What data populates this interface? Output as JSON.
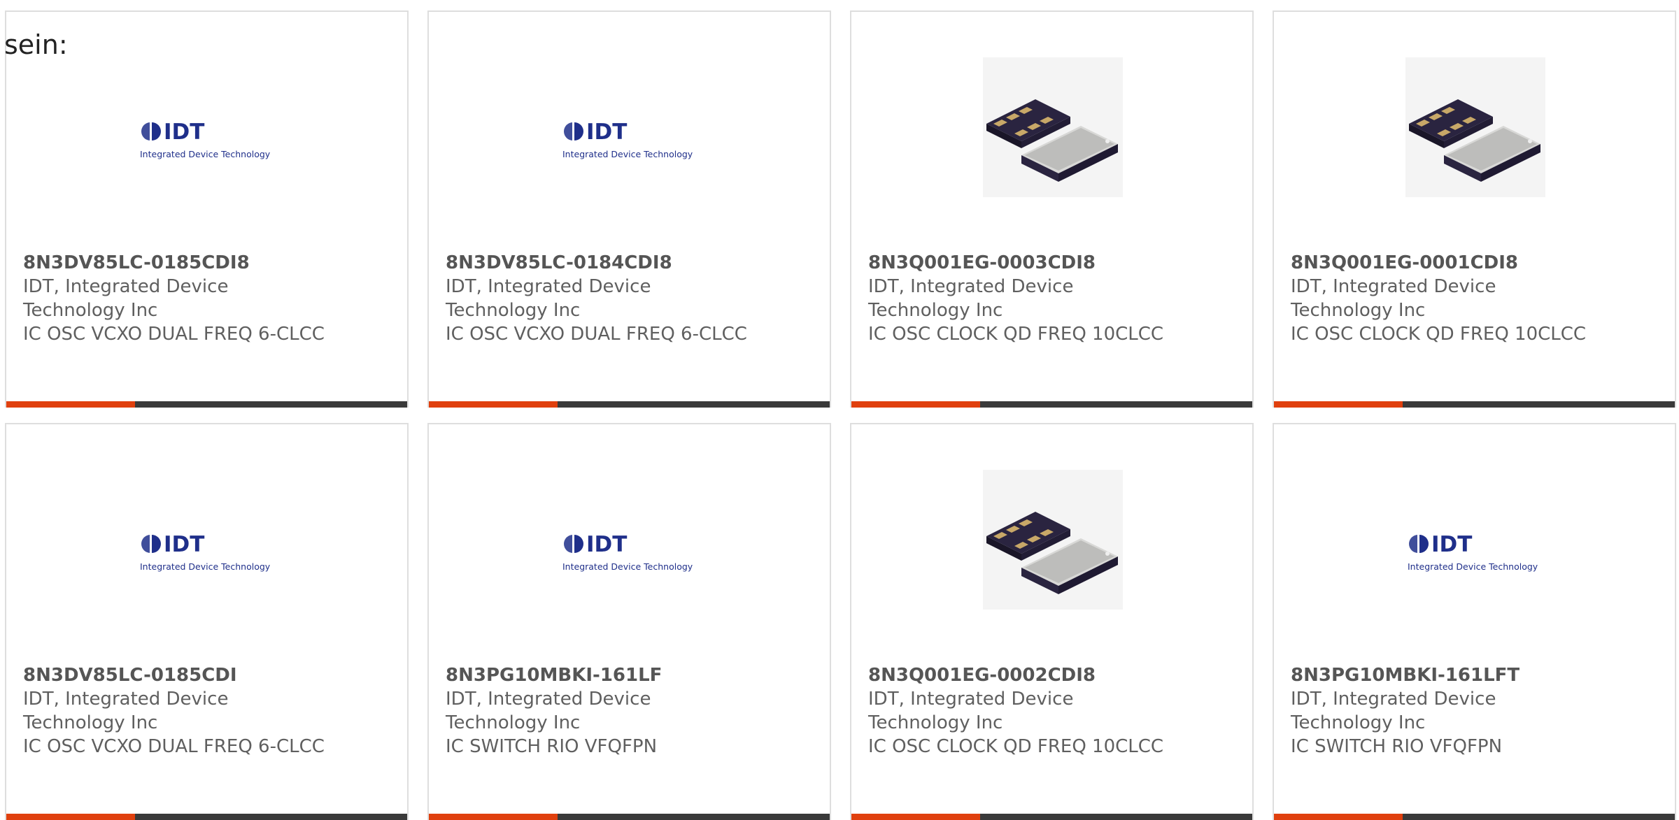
{
  "intro_text": "sein:",
  "icons": {
    "idt": "idt-logo",
    "osc": "oscillator-package-photo"
  },
  "colors": {
    "accent": "#e0400e",
    "bar": "#3a3a3a",
    "border": "#dedede"
  },
  "logo": {
    "mark": "IDT",
    "subtitle": "Integrated Device Technology"
  },
  "products": [
    {
      "part": "8N3DV85LC-0185CDI8",
      "maker_line1": "IDT, Integrated Device",
      "maker_line2": "Technology Inc",
      "desc": "IC OSC VCXO DUAL FREQ 6-CLCC",
      "image": "idt-logo"
    },
    {
      "part": "8N3DV85LC-0184CDI8",
      "maker_line1": "IDT, Integrated Device",
      "maker_line2": "Technology Inc",
      "desc": "IC OSC VCXO DUAL FREQ 6-CLCC",
      "image": "idt-logo"
    },
    {
      "part": "8N3Q001EG-0003CDI8",
      "maker_line1": "IDT, Integrated Device",
      "maker_line2": "Technology Inc",
      "desc": "IC OSC CLOCK QD FREQ 10CLCC",
      "image": "oscillator-package-photo"
    },
    {
      "part": "8N3Q001EG-0001CDI8",
      "maker_line1": "IDT, Integrated Device",
      "maker_line2": "Technology Inc",
      "desc": "IC OSC CLOCK QD FREQ 10CLCC",
      "image": "oscillator-package-photo"
    },
    {
      "part": "8N3DV85LC-0185CDI",
      "maker_line1": "IDT, Integrated Device",
      "maker_line2": "Technology Inc",
      "desc": "IC OSC VCXO DUAL FREQ 6-CLCC",
      "image": "idt-logo"
    },
    {
      "part": "8N3PG10MBKI-161LF",
      "maker_line1": "IDT, Integrated Device",
      "maker_line2": "Technology Inc",
      "desc": "IC SWITCH RIO VFQFPN",
      "image": "idt-logo"
    },
    {
      "part": "8N3Q001EG-0002CDI8",
      "maker_line1": "IDT, Integrated Device",
      "maker_line2": "Technology Inc",
      "desc": "IC OSC CLOCK QD FREQ 10CLCC",
      "image": "oscillator-package-photo"
    },
    {
      "part": "8N3PG10MBKI-161LFT",
      "maker_line1": "IDT, Integrated Device",
      "maker_line2": "Technology Inc",
      "desc": "IC SWITCH RIO VFQFPN",
      "image": "idt-logo"
    }
  ]
}
